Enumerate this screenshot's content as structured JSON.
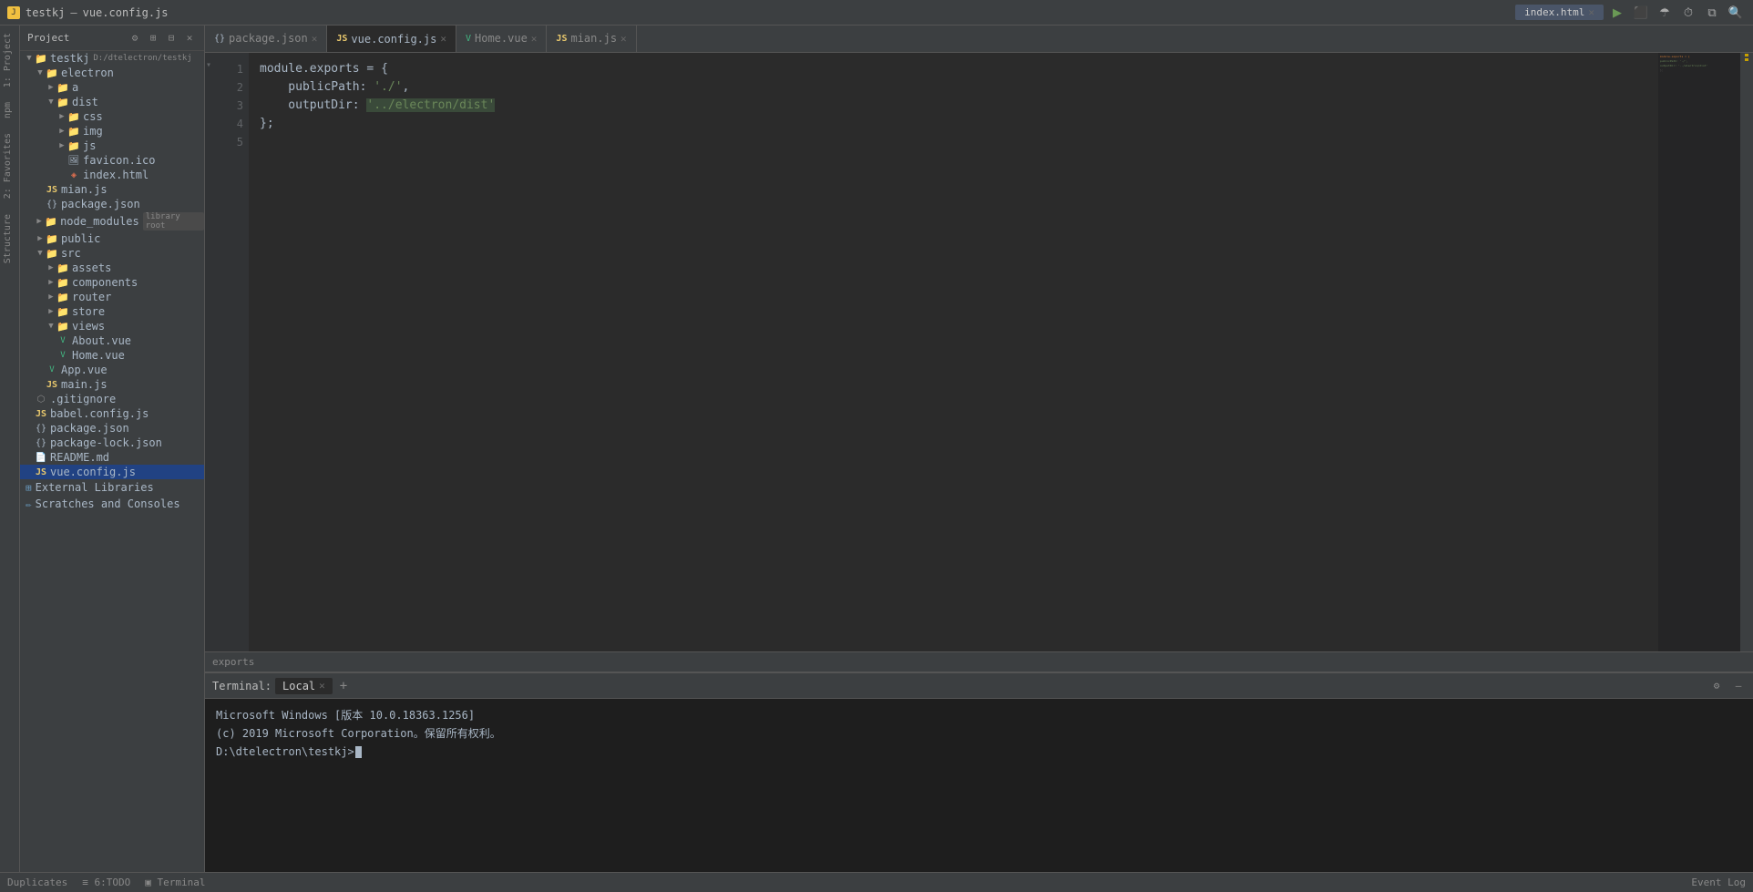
{
  "titleBar": {
    "projectLabel": "Project",
    "windowTitle": "testkj",
    "fileTitle": "vue.config.js",
    "tabLabel": "index.html",
    "buttons": {
      "run": "▶",
      "debug": "🐛",
      "settings": "⚙",
      "minimize": "—",
      "maximize": "□",
      "close": "✕",
      "search": "🔍"
    }
  },
  "sidebar": {
    "headerTitle": "Project",
    "rootProject": "testkj",
    "rootPath": "D:/dtelectron/testkj",
    "items": [
      {
        "name": "electron",
        "type": "folder",
        "depth": 1,
        "expanded": true
      },
      {
        "name": "a",
        "type": "folder",
        "depth": 2,
        "expanded": false
      },
      {
        "name": "dist",
        "type": "folder",
        "depth": 2,
        "expanded": true
      },
      {
        "name": "css",
        "type": "folder",
        "depth": 3,
        "expanded": false
      },
      {
        "name": "img",
        "type": "folder",
        "depth": 3,
        "expanded": false
      },
      {
        "name": "js",
        "type": "folder",
        "depth": 3,
        "expanded": false
      },
      {
        "name": "favicon.ico",
        "type": "ico",
        "depth": 3
      },
      {
        "name": "index.html",
        "type": "html",
        "depth": 3
      },
      {
        "name": "mian.js",
        "type": "js",
        "depth": 2
      },
      {
        "name": "package.json",
        "type": "json",
        "depth": 2
      },
      {
        "name": "node_modules",
        "type": "folder",
        "depth": 1,
        "badge": "library root",
        "expanded": false
      },
      {
        "name": "public",
        "type": "folder",
        "depth": 1,
        "expanded": false
      },
      {
        "name": "src",
        "type": "folder",
        "depth": 1,
        "expanded": true
      },
      {
        "name": "assets",
        "type": "folder",
        "depth": 2,
        "expanded": false
      },
      {
        "name": "components",
        "type": "folder",
        "depth": 2,
        "expanded": false
      },
      {
        "name": "router",
        "type": "folder",
        "depth": 2,
        "expanded": false
      },
      {
        "name": "store",
        "type": "folder",
        "depth": 2,
        "expanded": false
      },
      {
        "name": "views",
        "type": "folder",
        "depth": 2,
        "expanded": true
      },
      {
        "name": "About.vue",
        "type": "vue",
        "depth": 3
      },
      {
        "name": "Home.vue",
        "type": "vue",
        "depth": 3
      },
      {
        "name": "App.vue",
        "type": "vue",
        "depth": 2
      },
      {
        "name": "main.js",
        "type": "js",
        "depth": 2
      },
      {
        "name": ".gitignore",
        "type": "git",
        "depth": 1
      },
      {
        "name": "babel.config.js",
        "type": "js",
        "depth": 1
      },
      {
        "name": "package.json",
        "type": "json",
        "depth": 1
      },
      {
        "name": "package-lock.json",
        "type": "json",
        "depth": 1
      },
      {
        "name": "README.md",
        "type": "md",
        "depth": 1
      },
      {
        "name": "vue.config.js",
        "type": "js",
        "depth": 1,
        "selected": true
      }
    ],
    "externalLibraries": "External Libraries",
    "scratchesAndConsoles": "Scratches and Consoles"
  },
  "tabs": [
    {
      "name": "package.json",
      "type": "json",
      "active": false
    },
    {
      "name": "vue.config.js",
      "type": "js",
      "active": true
    },
    {
      "name": "Home.vue",
      "type": "vue",
      "active": false
    },
    {
      "name": "mian.js",
      "type": "js",
      "active": false
    }
  ],
  "code": {
    "lines": [
      {
        "num": 1,
        "content": "module.exports = {",
        "tokens": [
          {
            "text": "module",
            "cls": "prop"
          },
          {
            "text": ".",
            "cls": "punct"
          },
          {
            "text": "exports",
            "cls": "prop"
          },
          {
            "text": " = {",
            "cls": "punct"
          }
        ]
      },
      {
        "num": 2,
        "content": "    publicPath: './',",
        "tokens": [
          {
            "text": "    publicPath",
            "cls": "prop"
          },
          {
            "text": ": ",
            "cls": "punct"
          },
          {
            "text": "'./'",
            "cls": "str"
          },
          {
            "text": ",",
            "cls": "punct"
          }
        ]
      },
      {
        "num": 3,
        "content": "    outputDir: '../electron/dist'",
        "tokens": [
          {
            "text": "    outputDir",
            "cls": "prop"
          },
          {
            "text": ": ",
            "cls": "punct"
          },
          {
            "text": "'../electron/dist'",
            "cls": "str-highlight"
          }
        ]
      },
      {
        "num": 4,
        "content": "};",
        "tokens": [
          {
            "text": "};",
            "cls": "punct"
          }
        ]
      },
      {
        "num": 5,
        "content": "",
        "tokens": []
      }
    ]
  },
  "breadcrumb": {
    "label": "exports"
  },
  "terminal": {
    "tabLabel": "Terminal:",
    "tabs": [
      {
        "name": "Local",
        "active": true
      }
    ],
    "addButton": "+",
    "lines": [
      "Microsoft Windows [版本 10.0.18363.1256]",
      "(c) 2019 Microsoft Corporation。保留所有权利。",
      "",
      "D:\\dtelectron\\testkj>"
    ]
  },
  "statusBar": {
    "left": [
      {
        "label": "Duplicates"
      },
      {
        "label": "≡ 6:TODO"
      },
      {
        "label": "▣ Terminal"
      }
    ],
    "right": [
      {
        "label": "Event Log"
      }
    ]
  }
}
